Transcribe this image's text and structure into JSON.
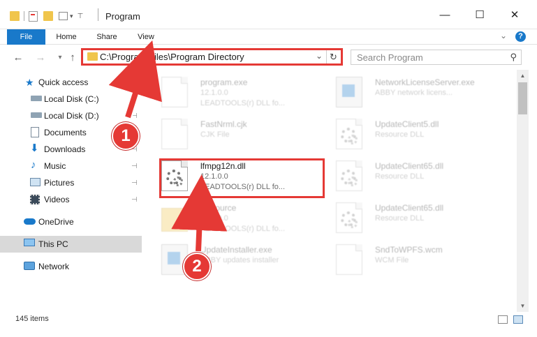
{
  "window": {
    "title": "Program",
    "minimize": "—",
    "maximize": "☐",
    "close": "✕"
  },
  "ribbon": {
    "tabs": [
      "File",
      "Home",
      "Share",
      "View"
    ],
    "expand": "⌄",
    "help": "?"
  },
  "address": {
    "path": "C:\\Program Files\\Program Directory",
    "refresh": "↻",
    "dropdown": "⌄"
  },
  "search": {
    "placeholder": "Search Program"
  },
  "nav": {
    "items": [
      {
        "label": "Quick access",
        "icon": "star-icon",
        "pinned": false
      },
      {
        "label": "Local Disk (C:)",
        "icon": "drive-icon",
        "pinned": true
      },
      {
        "label": "Local Disk (D:)",
        "icon": "drive-icon",
        "pinned": true
      },
      {
        "label": "Documents",
        "icon": "documents-icon",
        "pinned": true
      },
      {
        "label": "Downloads",
        "icon": "download-icon",
        "pinned": true
      },
      {
        "label": "Music",
        "icon": "music-icon",
        "pinned": true
      },
      {
        "label": "Pictures",
        "icon": "pictures-icon",
        "pinned": true
      },
      {
        "label": "Videos",
        "icon": "videos-icon",
        "pinned": true
      },
      {
        "label": "OneDrive",
        "icon": "cloud-icon",
        "pinned": false
      },
      {
        "label": "This PC",
        "icon": "computer-icon",
        "pinned": false,
        "selected": true
      },
      {
        "label": "Network",
        "icon": "network-icon",
        "pinned": false
      }
    ],
    "pin_glyph": "📌"
  },
  "files": [
    {
      "name": "program.exe",
      "line2": "12.1.0.0",
      "line3": "LEADTOOLS(r) DLL fo...",
      "icon": "exe-icon"
    },
    {
      "name": "NetworkLicenseServer.exe",
      "line2": "ABBY network licens...",
      "line3": "",
      "icon": "exe-icon"
    },
    {
      "name": "FastNrml.cjk",
      "line2": "CJK File",
      "line3": "",
      "icon": "document-icon"
    },
    {
      "name": "UpdateClient5.dll",
      "line2": "Resource DLL",
      "line3": "",
      "icon": "dll-icon"
    },
    {
      "name": "lfmpg12n.dll",
      "line2": "12.1.0.0",
      "line3": "LEADTOOLS(r) DLL fo...",
      "icon": "dll-icon"
    },
    {
      "name": "UpdateClient65.dll",
      "line2": "Resource DLL",
      "line3": "",
      "icon": "dll-icon"
    },
    {
      "name": "Resource",
      "line2": "12.1.0.0",
      "line3": "LEADTOOLS(r) DLL fo...",
      "icon": "folder-icon"
    },
    {
      "name": "UpdateClient65.dll",
      "line2": "Resource DLL",
      "line3": "",
      "icon": "dll-icon"
    },
    {
      "name": "UpdateInstaller.exe",
      "line2": "ABBY updates installer",
      "line3": "",
      "icon": "exe-icon"
    },
    {
      "name": "SndToWPFS.wcm",
      "line2": "WCM File",
      "line3": "",
      "icon": "document-icon"
    }
  ],
  "status": {
    "item_count": "145 items"
  },
  "callouts": {
    "one": "1",
    "two": "2"
  },
  "colors": {
    "accent": "#1979ca",
    "highlight_red": "#e53935",
    "selected_nav": "#d9d9d9"
  }
}
